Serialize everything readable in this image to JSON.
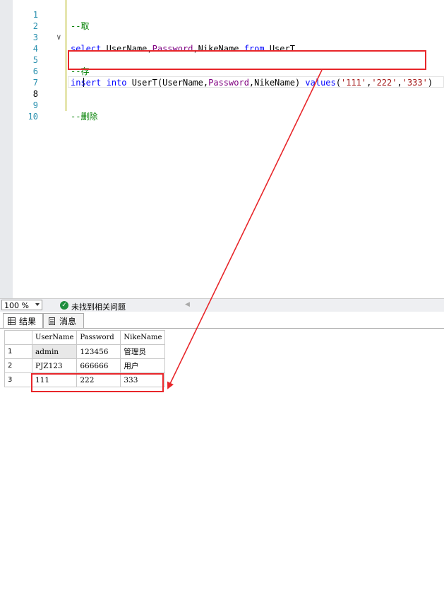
{
  "editor": {
    "lines": [
      {
        "no": "1",
        "text": "--取"
      },
      {
        "no": "2",
        "fold": "v"
      },
      {
        "no": "3"
      },
      {
        "no": "4"
      },
      {
        "no": "5",
        "text": "--存"
      },
      {
        "no": "6"
      },
      {
        "no": "7"
      },
      {
        "no": "8"
      },
      {
        "no": "9",
        "text": "--删除"
      },
      {
        "no": "10"
      }
    ],
    "select_stmt": {
      "kw1": "select",
      "f1": "UserName",
      "f2": "Password",
      "f3": "NikeName",
      "kw2": "from",
      "table": "UserT"
    },
    "insert_stmt": {
      "kw1": "insert",
      "kw2": "into",
      "table": "UserT",
      "f1": "UserName",
      "f2": "Password",
      "f3": "NikeName",
      "kw3": "values",
      "v1": "'111'",
      "v2": "'222'",
      "v3": "'333'"
    }
  },
  "status": {
    "zoom": "100 %",
    "message": "未找到相关问题"
  },
  "tabs": {
    "results": "结果",
    "messages": "消息"
  },
  "grid": {
    "headers": [
      "UserName",
      "Password",
      "NikeName"
    ],
    "rows": [
      {
        "n": "1",
        "c": [
          "admin",
          "123456",
          "管理员"
        ]
      },
      {
        "n": "2",
        "c": [
          "PJZ123",
          "666666",
          "用户"
        ]
      },
      {
        "n": "3",
        "c": [
          "111",
          "222",
          "333"
        ]
      }
    ]
  },
  "colors": {
    "highlight": "#e8262a",
    "keyword": "#0000ff",
    "comment": "#008000",
    "string": "#a31515",
    "column": "#800080"
  }
}
